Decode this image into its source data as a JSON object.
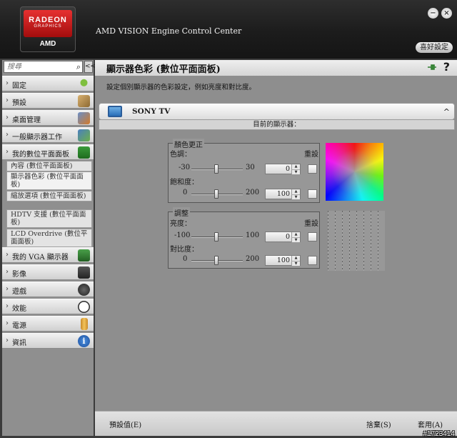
{
  "header": {
    "logo_brand": "RADEON",
    "logo_sub": "GRAPHICS",
    "logo_maker": "AMD",
    "app_title": "AMD VISION Engine Control Center",
    "prefs_label": "喜好設定",
    "minimize_glyph": "−",
    "close_glyph": "×"
  },
  "sidebar": {
    "search_placeholder": "搜尋",
    "search_icon": "search-icon",
    "collapse_glyph": "<<",
    "items": [
      {
        "label": "固定",
        "icon": "pin-icon"
      },
      {
        "label": "預設",
        "icon": "presets-icon"
      },
      {
        "label": "桌面管理",
        "icon": "desktop-icon"
      },
      {
        "label": "一般顯示器工作",
        "icon": "display-tasks-icon"
      },
      {
        "label": "我的數位平面面板",
        "icon": "flat-panel-icon"
      },
      {
        "label": "我的 VGA 顯示器",
        "icon": "vga-icon"
      },
      {
        "label": "影像",
        "icon": "video-icon"
      },
      {
        "label": "遊戲",
        "icon": "gaming-icon"
      },
      {
        "label": "效能",
        "icon": "performance-icon"
      },
      {
        "label": "電源",
        "icon": "power-icon"
      },
      {
        "label": "資訊",
        "icon": "info-icon"
      }
    ],
    "subitems": [
      "內容 (數位平面面板)",
      "顯示器色彩 (數位平面面板)",
      "縮放選項 (數位平面面板)",
      "HDTV 支援 (數位平面面板)",
      "LCD Overdrive (數位平面面板)"
    ],
    "arrow": "›"
  },
  "main": {
    "title": "顯示器色彩 (數位平面面板)",
    "help_glyph": "?",
    "description": "設定個別顯示器的色彩設定，例如亮度和對比度。",
    "display_name": "SONY TV",
    "display_caption": "目前的顯示器：",
    "chevron": "^",
    "color_group": {
      "title": "顏色更正",
      "reset_label": "重設",
      "hue": {
        "label": "色調：",
        "min": "-30",
        "max": "30",
        "value": "0",
        "fraction": 0.5
      },
      "saturation": {
        "label": "飽和度：",
        "min": "0",
        "max": "200",
        "value": "100",
        "fraction": 0.5
      }
    },
    "adjust_group": {
      "title": "調整",
      "reset_label": "重設",
      "brightness": {
        "label": "亮度：",
        "min": "-100",
        "max": "100",
        "value": "0",
        "fraction": 0.5
      },
      "contrast": {
        "label": "對比度：",
        "min": "0",
        "max": "200",
        "value": "100",
        "fraction": 0.5
      }
    },
    "footer": {
      "defaults_label": "預設值(E)",
      "discard_label": "捨棄(S)",
      "apply_label": "套用(A)"
    }
  },
  "watermark": "#1723414"
}
